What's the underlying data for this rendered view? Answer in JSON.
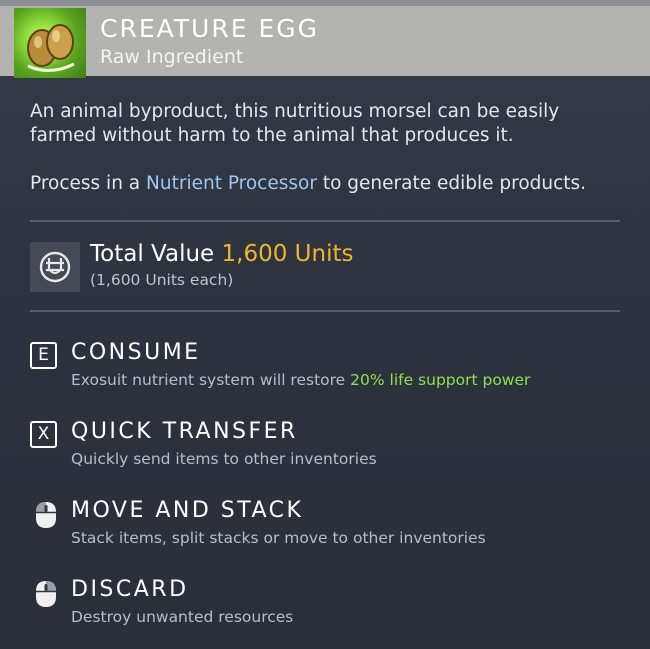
{
  "item": {
    "name": "CREATURE EGG",
    "category": "Raw Ingredient",
    "icon": "creature-egg-icon"
  },
  "description": {
    "line1": "An animal byproduct, this nutritious morsel can be easily farmed without harm to the animal that produces it.",
    "process_prefix": "Process in a ",
    "process_link": "Nutrient Processor",
    "process_suffix": " to generate edible products."
  },
  "value": {
    "label": "Total Value",
    "amount": "1,600 Units",
    "each": "(1,600 Units each)",
    "icon": "units-currency-icon"
  },
  "actions": [
    {
      "key": "E",
      "title": "CONSUME",
      "desc_prefix": "Exosuit nutrient system will restore ",
      "desc_highlight": "20% life support power"
    },
    {
      "key": "X",
      "title": "QUICK TRANSFER",
      "desc": "Quickly send items to other inventories"
    },
    {
      "icon": "mouse-icon",
      "title": "MOVE AND STACK",
      "desc": "Stack items, split stacks or move to other inventories"
    },
    {
      "icon": "mouse-icon",
      "title": "DISCARD",
      "desc": "Destroy unwanted resources"
    }
  ],
  "colors": {
    "header_bg": "#b3b3b1",
    "panel_bg": "#2f3540",
    "units_gold": "#f2b52a",
    "link_blue": "#9fc6f0",
    "highlight_green": "#8ee04f"
  }
}
